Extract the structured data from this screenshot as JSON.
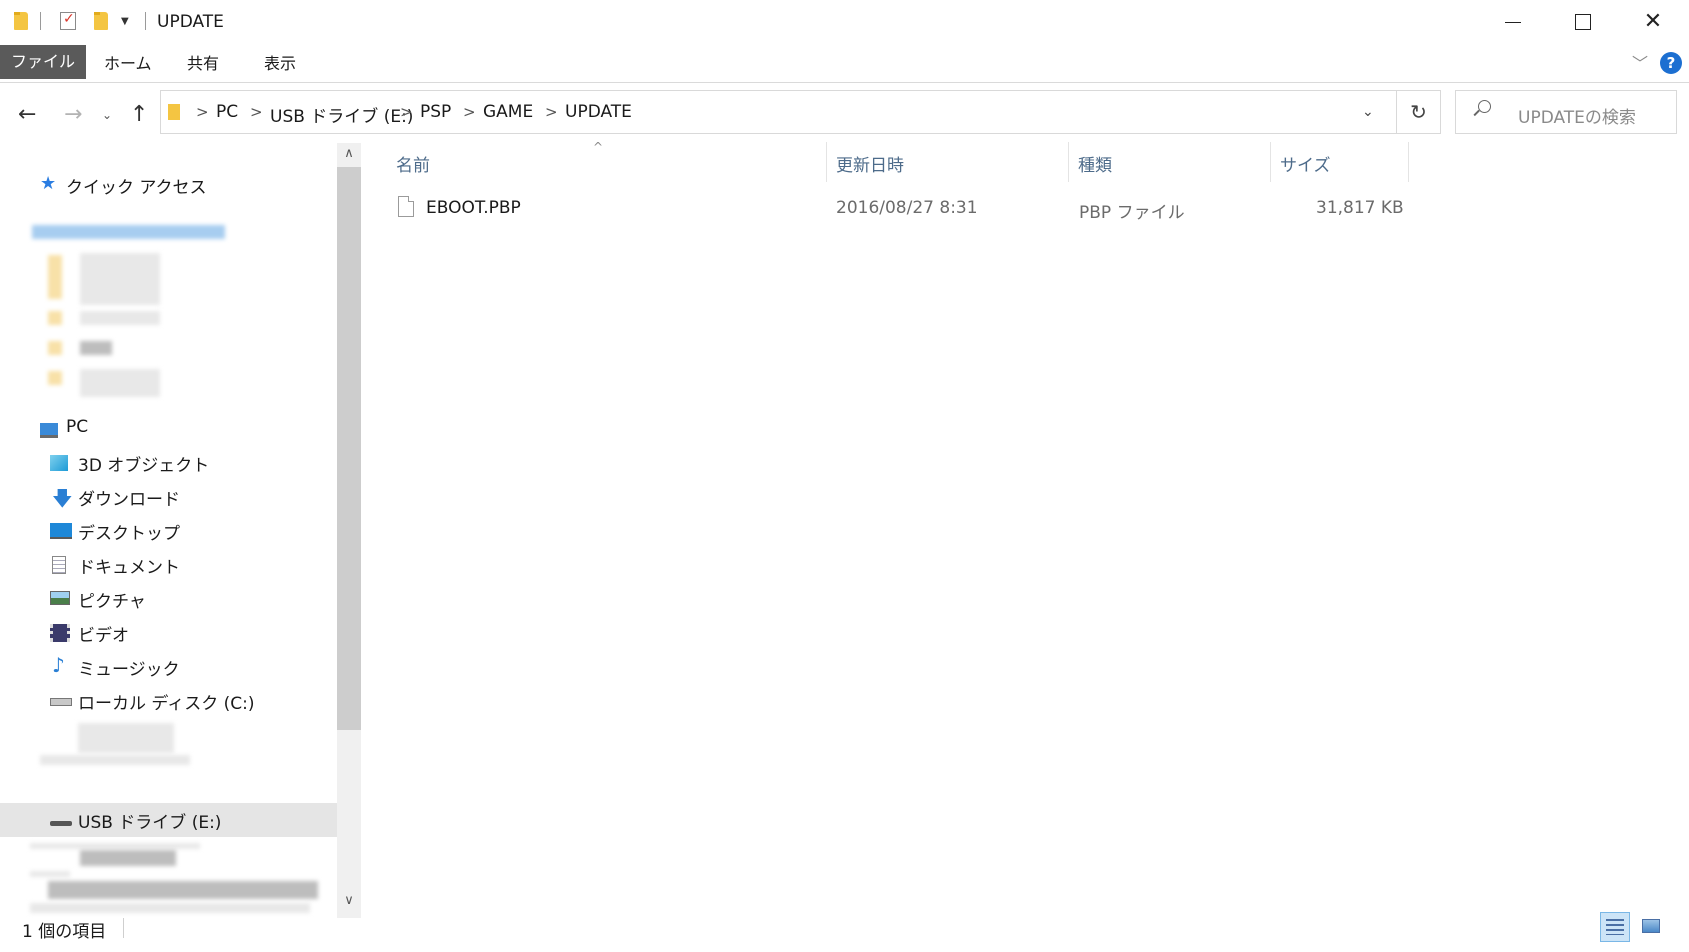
{
  "window": {
    "title": "UPDATE"
  },
  "ribbon": {
    "tabs": [
      "ファイル",
      "ホーム",
      "共有",
      "表示"
    ],
    "help": "?"
  },
  "address": {
    "crumbs": [
      "PC",
      "USB ドライブ (E:)",
      "PSP",
      "GAME",
      "UPDATE"
    ],
    "separator": ">"
  },
  "search": {
    "placeholder": "UPDATEの検索"
  },
  "sidebar": {
    "quick_access": "クイック アクセス",
    "pc": "PC",
    "items": [
      {
        "label": "3D オブジェクト",
        "icon": "3d-objects-icon"
      },
      {
        "label": "ダウンロード",
        "icon": "download-icon"
      },
      {
        "label": "デスクトップ",
        "icon": "desktop-icon"
      },
      {
        "label": "ドキュメント",
        "icon": "documents-icon"
      },
      {
        "label": "ピクチャ",
        "icon": "pictures-icon"
      },
      {
        "label": "ビデオ",
        "icon": "videos-icon"
      },
      {
        "label": "ミュージック",
        "icon": "music-icon"
      },
      {
        "label": "ローカル ディスク (C:)",
        "icon": "local-disk-icon"
      }
    ],
    "usb": "USB ドライブ (E:)"
  },
  "columns": {
    "name": "名前",
    "date": "更新日時",
    "type": "種類",
    "size": "サイズ"
  },
  "files": [
    {
      "name": "EBOOT.PBP",
      "date": "2016/08/27 8:31",
      "type": "PBP ファイル",
      "size": "31,817 KB"
    }
  ],
  "status": {
    "count": "1 個の項目"
  },
  "colors": {
    "file_tab": "#5a5a5a",
    "selected_nav": "#e5e5e5",
    "folder": "#f4c542",
    "help": "#1c6fd1"
  }
}
